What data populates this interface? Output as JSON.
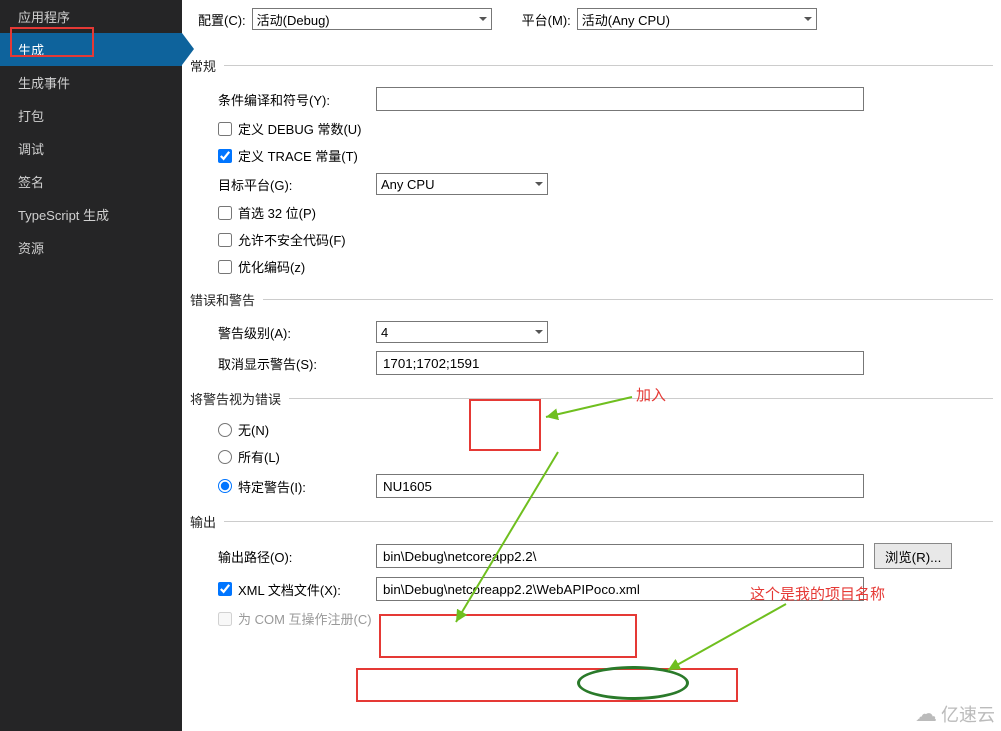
{
  "sidebar": {
    "items": [
      {
        "label": "应用程序"
      },
      {
        "label": "生成"
      },
      {
        "label": "生成事件"
      },
      {
        "label": "打包"
      },
      {
        "label": "调试"
      },
      {
        "label": "签名"
      },
      {
        "label": "TypeScript 生成"
      },
      {
        "label": "资源"
      }
    ]
  },
  "top": {
    "config_label": "配置(C):",
    "config_value": "活动(Debug)",
    "platform_label": "平台(M):",
    "platform_value": "活动(Any CPU)"
  },
  "sections": {
    "general": {
      "title": "常规",
      "cond_label": "条件编译和符号(Y):",
      "cond_value": "",
      "debug_const": "定义 DEBUG 常数(U)",
      "trace_const": "定义 TRACE 常量(T)",
      "target_platform_label": "目标平台(G):",
      "target_platform_value": "Any CPU",
      "prefer32": "首选 32 位(P)",
      "unsafe": "允许不安全代码(F)",
      "optimize": "优化编码(z)"
    },
    "errors": {
      "title": "错误和警告",
      "warn_level_label": "警告级别(A):",
      "warn_level_value": "4",
      "suppress_label": "取消显示警告(S):",
      "suppress_value": "1701;1702;1591"
    },
    "treat": {
      "title": "将警告视为错误",
      "none": "无(N)",
      "all": "所有(L)",
      "specific": "特定警告(I):",
      "specific_value": "NU1605"
    },
    "output": {
      "title": "输出",
      "path_label": "输出路径(O):",
      "path_value": "bin\\Debug\\netcoreapp2.2\\",
      "browse": "浏览(R)...",
      "xml_label": "XML 文档文件(X):",
      "xml_value": "bin\\Debug\\netcoreapp2.2\\WebAPIPoco.xml",
      "com_label": "为 COM 互操作注册(C)"
    }
  },
  "annotations": {
    "add": "加入",
    "project_name": "这个是我的项目名称"
  },
  "logo": "亿速云"
}
